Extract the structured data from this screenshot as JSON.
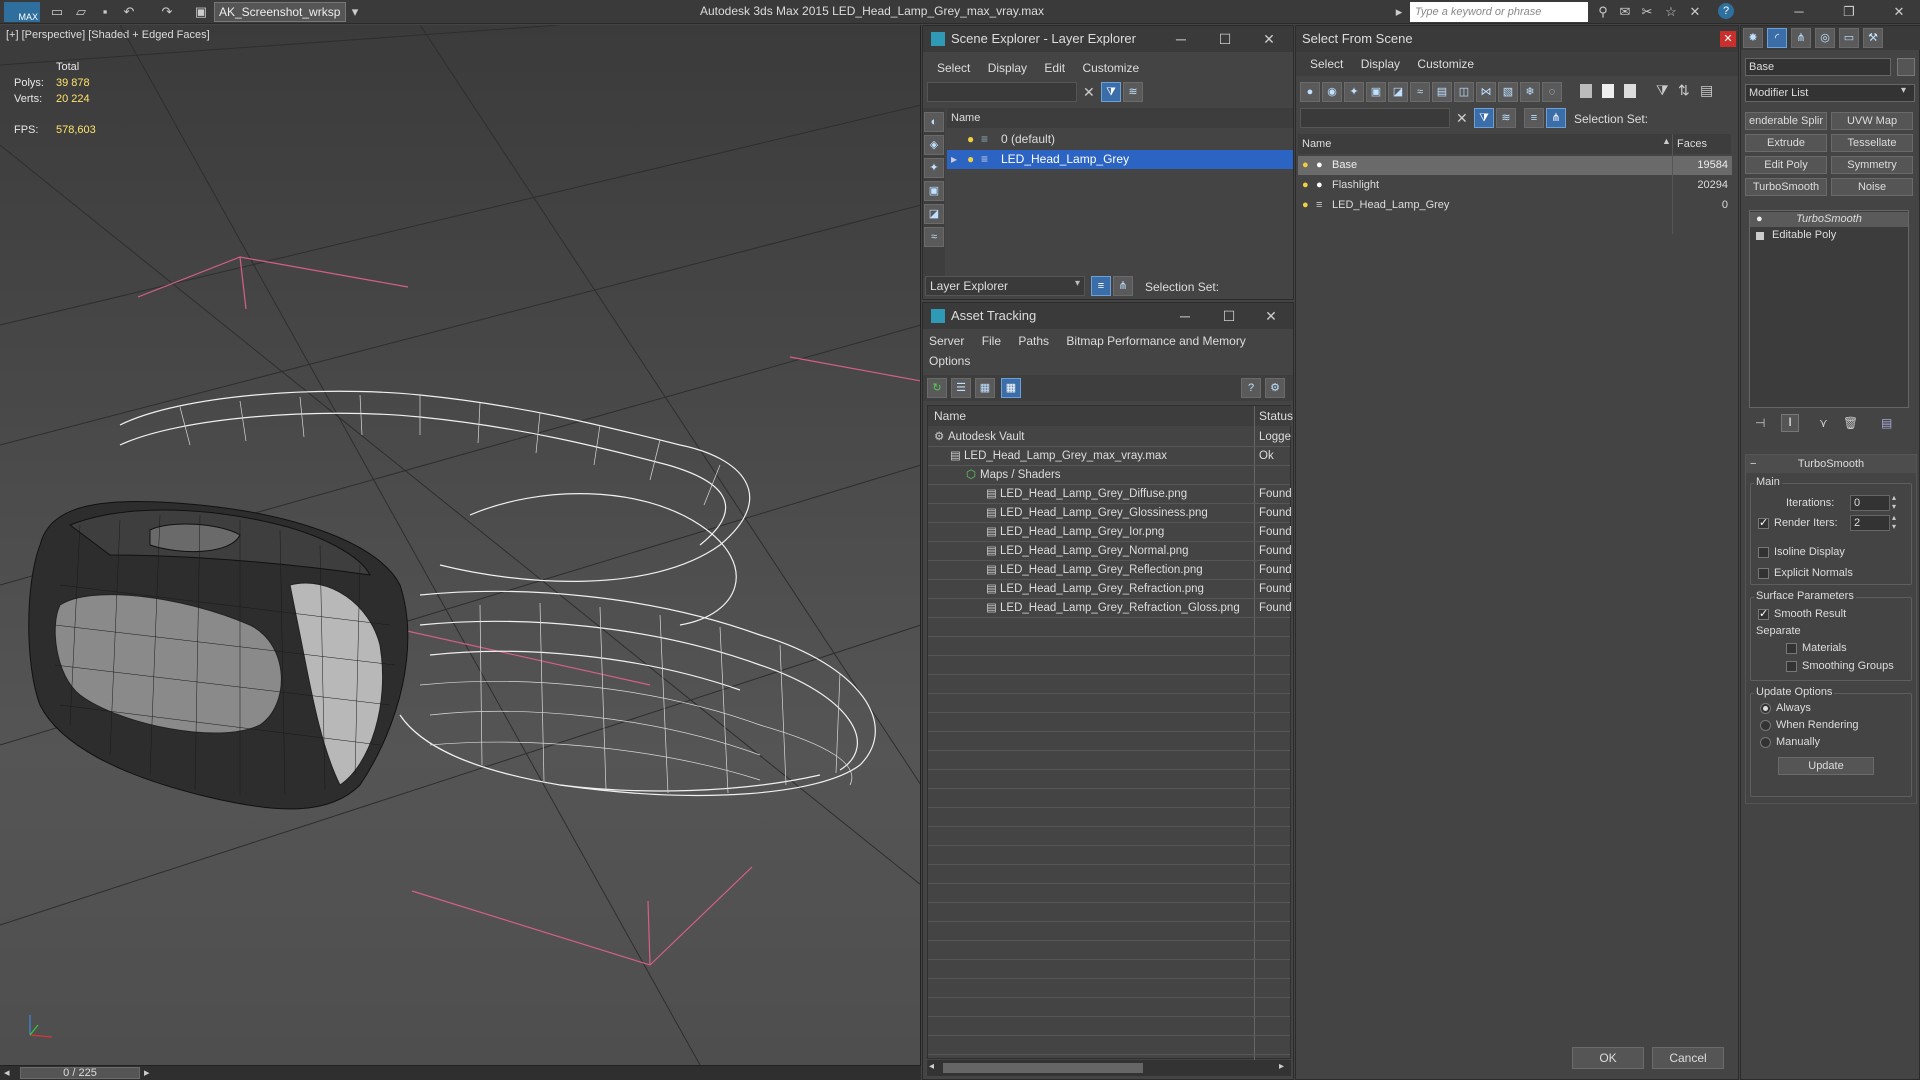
{
  "titlebar": {
    "app_logo": "MAX",
    "workspace": "AK_Screenshot_wrksp",
    "app_title": "Autodesk 3ds Max  2015      LED_Head_Lamp_Grey_max_vray.max",
    "search_placeholder": "Type a keyword or phrase"
  },
  "viewport": {
    "label": "[+] [Perspective] [Shaded + Edged Faces]",
    "stats": {
      "total_label": "Total",
      "polys_label": "Polys:",
      "polys_value": "39 878",
      "verts_label": "Verts:",
      "verts_value": "20 224",
      "fps_label": "FPS:",
      "fps_value": "578,603"
    },
    "timeline": "0 / 225"
  },
  "scene_explorer": {
    "title": "Scene Explorer - Layer Explorer",
    "menu": [
      "Select",
      "Display",
      "Edit",
      "Customize"
    ],
    "column_name": "Name",
    "layers": [
      {
        "name": "0 (default)",
        "selected": false
      },
      {
        "name": "LED_Head_Lamp_Grey",
        "selected": true
      }
    ],
    "footer_dropdown": "Layer Explorer",
    "selection_set_label": "Selection Set:"
  },
  "asset_tracking": {
    "title": "Asset Tracking",
    "menu": [
      "Server",
      "File",
      "Paths",
      "Bitmap Performance and Memory"
    ],
    "menu2": "Options",
    "col_name": "Name",
    "col_status": "Status",
    "rows": [
      {
        "name": "Autodesk Vault",
        "status": "Logge",
        "indent": 0
      },
      {
        "name": "LED_Head_Lamp_Grey_max_vray.max",
        "status": "Ok",
        "indent": 1
      },
      {
        "name": "Maps / Shaders",
        "status": "",
        "indent": 2
      },
      {
        "name": "LED_Head_Lamp_Grey_Diffuse.png",
        "status": "Found",
        "indent": 3
      },
      {
        "name": "LED_Head_Lamp_Grey_Glossiness.png",
        "status": "Found",
        "indent": 3
      },
      {
        "name": "LED_Head_Lamp_Grey_Ior.png",
        "status": "Found",
        "indent": 3
      },
      {
        "name": "LED_Head_Lamp_Grey_Normal.png",
        "status": "Found",
        "indent": 3
      },
      {
        "name": "LED_Head_Lamp_Grey_Reflection.png",
        "status": "Found",
        "indent": 3
      },
      {
        "name": "LED_Head_Lamp_Grey_Refraction.png",
        "status": "Found",
        "indent": 3
      },
      {
        "name": "LED_Head_Lamp_Grey_Refraction_Gloss.png",
        "status": "Found",
        "indent": 3
      }
    ]
  },
  "select_from_scene": {
    "title": "Select From Scene",
    "menu": [
      "Select",
      "Display",
      "Customize"
    ],
    "selection_set_label": "Selection Set:",
    "col_name": "Name",
    "col_faces": "Faces",
    "rows": [
      {
        "name": "Base",
        "faces": "19584",
        "selected": true
      },
      {
        "name": "Flashlight",
        "faces": "20294",
        "selected": false
      },
      {
        "name": "LED_Head_Lamp_Grey",
        "faces": "0",
        "selected": false
      }
    ],
    "ok_label": "OK",
    "cancel_label": "Cancel"
  },
  "command_panel": {
    "object_name": "Base",
    "modifier_list": "Modifier List",
    "buttons": [
      "enderable Splir",
      "UVW Map",
      "Extrude",
      "Tessellate",
      "Edit Poly",
      "Symmetry",
      "TurboSmooth",
      "Noise"
    ],
    "stack": [
      "TurboSmooth",
      "Editable Poly"
    ],
    "rollout_title": "TurboSmooth",
    "main_label": "Main",
    "iterations_label": "Iterations:",
    "iterations_value": "0",
    "render_iters_label": "Render Iters:",
    "render_iters_value": "2",
    "isoline_label": "Isoline Display",
    "explicit_normals_label": "Explicit Normals",
    "surface_params_label": "Surface Parameters",
    "smooth_result_label": "Smooth Result",
    "separate_label": "Separate",
    "materials_label": "Materials",
    "smoothing_groups_label": "Smoothing Groups",
    "update_options_label": "Update Options",
    "always_label": "Always",
    "when_rendering_label": "When Rendering",
    "manually_label": "Manually",
    "update_button": "Update"
  }
}
